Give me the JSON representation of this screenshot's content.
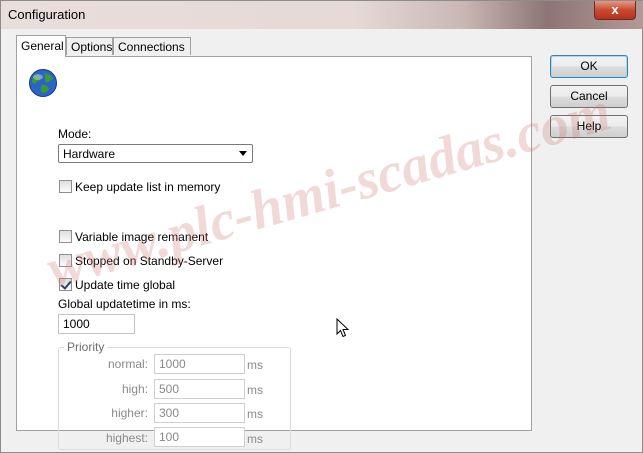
{
  "window": {
    "title": "Configuration",
    "close_label": "x"
  },
  "tabs": [
    {
      "label": "General",
      "active": true
    },
    {
      "label": "Options",
      "active": false
    },
    {
      "label": "Connections",
      "active": false
    }
  ],
  "general": {
    "mode_label": "Mode:",
    "mode_value": "Hardware",
    "keep_update_label": "Keep update list in memory",
    "keep_update_checked": false,
    "variable_image_label": "Variable image remanent",
    "variable_image_checked": false,
    "stopped_standby_label": "Stopped on Standby-Server",
    "stopped_standby_checked": false,
    "update_time_global_label": "Update time global",
    "update_time_global_checked": true,
    "global_updatetime_label": "Global updatetime in ms:",
    "global_updatetime_value": "1000",
    "priority": {
      "title": "Priority",
      "rows": [
        {
          "label": "normal:",
          "value": "1000",
          "unit": "ms"
        },
        {
          "label": "high:",
          "value": "500",
          "unit": "ms"
        },
        {
          "label": "higher:",
          "value": "300",
          "unit": "ms"
        },
        {
          "label": "highest:",
          "value": "100",
          "unit": "ms"
        }
      ]
    }
  },
  "buttons": {
    "ok": "OK",
    "cancel": "Cancel",
    "help": "Help"
  },
  "watermark": "www.plc-hmi-scadas.com",
  "icons": {
    "app": "globe-icon",
    "cursor": "mouse-pointer-icon"
  }
}
